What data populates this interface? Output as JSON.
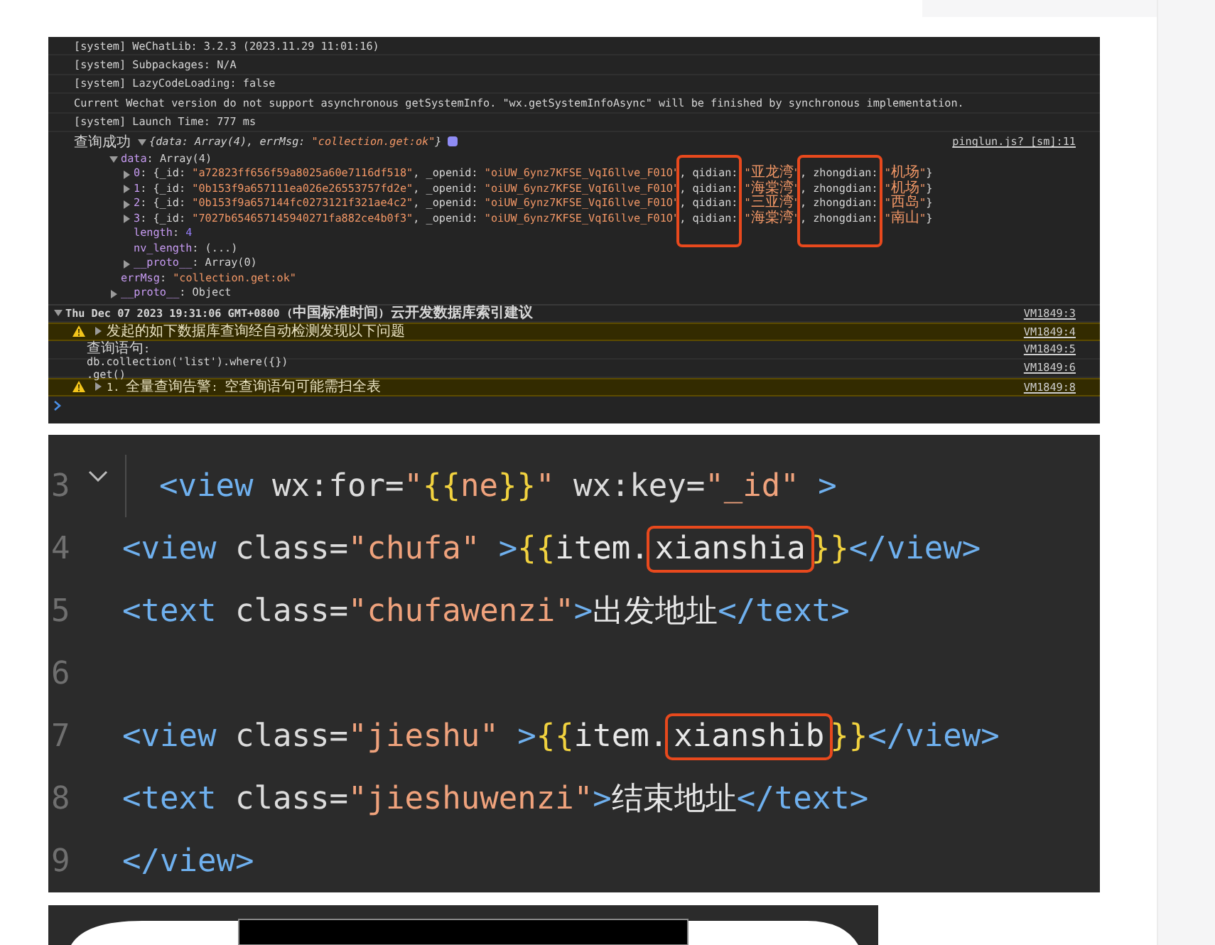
{
  "console": {
    "lines": [
      {
        "kind": "log",
        "text": "[system] WeChatLib: 3.2.3 (2023.11.29 11:01:16)"
      },
      {
        "kind": "log",
        "text": "[system] Subpackages: N/A"
      },
      {
        "kind": "log",
        "text": "[system] LazyCodeLoading: false"
      },
      {
        "kind": "log",
        "text": "Current Wechat version do not support asynchronous getSystemInfo. \"wx.getSystemInfoAsync\" will be finished by synchronous implementation."
      },
      {
        "kind": "log",
        "text": "[system] Launch Time: 777 ms"
      },
      {
        "kind": "object",
        "label": "查询成功",
        "expanded": true,
        "summary": [
          {
            "kind": "plain",
            "text": "{data: Array(4), errMsg: "
          },
          {
            "kind": "string",
            "text": "\"collection.get:ok\""
          },
          {
            "kind": "plain",
            "text": "}"
          }
        ],
        "source": "pinglun.js? [sm]:11",
        "children": [
          {
            "expanded": true,
            "tokens": [
              {
                "kind": "key",
                "text": "data"
              },
              {
                "kind": "plain",
                "text": ": Array(4)"
              }
            ],
            "children": [
              {
                "expanded": false,
                "tokens": [
                  {
                    "kind": "key",
                    "text": "0"
                  },
                  {
                    "kind": "plain",
                    "text": ": {_id: "
                  },
                  {
                    "kind": "string",
                    "text": "\"a72823ff656f59a8025a60e7116df518\""
                  },
                  {
                    "kind": "plain",
                    "text": ", _openid: "
                  },
                  {
                    "kind": "string",
                    "text": "\"oiUW_6ynz7KFSE_VqI6llve_F01O\""
                  },
                  {
                    "kind": "plain",
                    "text": ", qidian:",
                    "highlighted": true
                  },
                  {
                    "kind": "string",
                    "text": " \"亚龙湾\""
                  },
                  {
                    "kind": "plain",
                    "text": ", zhongdian:",
                    "highlighted": true
                  },
                  {
                    "kind": "string",
                    "text": " \"机场\""
                  },
                  {
                    "kind": "plain",
                    "text": "}"
                  }
                ]
              },
              {
                "expanded": false,
                "tokens": [
                  {
                    "kind": "key",
                    "text": "1"
                  },
                  {
                    "kind": "plain",
                    "text": ": {_id: "
                  },
                  {
                    "kind": "string",
                    "text": "\"0b153f9a657111ea026e26553757fd2e\""
                  },
                  {
                    "kind": "plain",
                    "text": ", _openid: "
                  },
                  {
                    "kind": "string",
                    "text": "\"oiUW_6ynz7KFSE_VqI6llve_F01O\""
                  },
                  {
                    "kind": "plain",
                    "text": ", qidian:",
                    "highlighted": true
                  },
                  {
                    "kind": "string",
                    "text": " \"海棠湾\""
                  },
                  {
                    "kind": "plain",
                    "text": ", zhongdian:",
                    "highlighted": true
                  },
                  {
                    "kind": "string",
                    "text": " \"机场\""
                  },
                  {
                    "kind": "plain",
                    "text": "}"
                  }
                ]
              },
              {
                "expanded": false,
                "tokens": [
                  {
                    "kind": "key",
                    "text": "2"
                  },
                  {
                    "kind": "plain",
                    "text": ": {_id: "
                  },
                  {
                    "kind": "string",
                    "text": "\"0b153f9a657144fc0273121f321ae4c2\""
                  },
                  {
                    "kind": "plain",
                    "text": ", _openid: "
                  },
                  {
                    "kind": "string",
                    "text": "\"oiUW_6ynz7KFSE_VqI6llve_F01O\""
                  },
                  {
                    "kind": "plain",
                    "text": ", qidian:",
                    "highlighted": true
                  },
                  {
                    "kind": "string",
                    "text": " \"三亚湾\""
                  },
                  {
                    "kind": "plain",
                    "text": ", zhongdian:",
                    "highlighted": true
                  },
                  {
                    "kind": "string",
                    "text": " \"西岛\""
                  },
                  {
                    "kind": "plain",
                    "text": "}"
                  }
                ]
              },
              {
                "expanded": false,
                "tokens": [
                  {
                    "kind": "key",
                    "text": "3"
                  },
                  {
                    "kind": "plain",
                    "text": ": {_id: "
                  },
                  {
                    "kind": "string",
                    "text": "\"7027b654657145940271fa882ce4b0f3\""
                  },
                  {
                    "kind": "plain",
                    "text": ", _openid: "
                  },
                  {
                    "kind": "string",
                    "text": "\"oiUW_6ynz7KFSE_VqI6llve_F01O\""
                  },
                  {
                    "kind": "plain",
                    "text": ", qidian:",
                    "highlighted": true
                  },
                  {
                    "kind": "string",
                    "text": " \"海棠湾\""
                  },
                  {
                    "kind": "plain",
                    "text": ", zhongdian:",
                    "highlighted": true
                  },
                  {
                    "kind": "string",
                    "text": " \"南山\""
                  },
                  {
                    "kind": "plain",
                    "text": "}"
                  }
                ]
              },
              {
                "tokens": [
                  {
                    "kind": "key",
                    "text": "length"
                  },
                  {
                    "kind": "plain",
                    "text": ": "
                  },
                  {
                    "kind": "number",
                    "text": "4"
                  }
                ]
              },
              {
                "tokens": [
                  {
                    "kind": "key",
                    "text": "nv_length"
                  },
                  {
                    "kind": "plain",
                    "text": ": (...)"
                  }
                ]
              },
              {
                "expanded": false,
                "tokens": [
                  {
                    "kind": "key",
                    "text": "__proto__"
                  },
                  {
                    "kind": "plain",
                    "text": ": Array(0)"
                  }
                ]
              }
            ]
          },
          {
            "tokens": [
              {
                "kind": "key",
                "text": "errMsg"
              },
              {
                "kind": "plain",
                "text": ": "
              },
              {
                "kind": "string",
                "text": "\"collection.get:ok\""
              }
            ]
          },
          {
            "expanded": false,
            "tokens": [
              {
                "kind": "key",
                "text": "__proto__"
              },
              {
                "kind": "plain",
                "text": ": Object"
              }
            ]
          }
        ]
      },
      {
        "kind": "group",
        "expanded": true,
        "text": "Thu Dec 07 2023 19:31:06 GMT+0800 (中国标准时间) 云开发数据库索引建议",
        "source": "VM1849:3",
        "children": [
          {
            "kind": "warning",
            "expanded": false,
            "text": "发起的如下数据库查询经自动检测发现以下问题",
            "source": "VM1849:4"
          },
          {
            "kind": "log",
            "text": "查询语句:",
            "source": "VM1849:5"
          },
          {
            "kind": "log",
            "text": "db.collection('list').where({})\n.get()",
            "source": "VM1849:6"
          },
          {
            "kind": "warning",
            "expanded": false,
            "text": "1. 全量查询告警: 空查询语句可能需扫全表",
            "source": "VM1849:8"
          }
        ]
      }
    ]
  },
  "code": {
    "lines": [
      {
        "number": "3",
        "expanded": true,
        "tokens": [
          {
            "kind": "tag",
            "text": "<view"
          },
          {
            "kind": "attr",
            "text": " wx:for="
          },
          {
            "kind": "string",
            "text": "\""
          },
          {
            "kind": "brace",
            "text": "{{"
          },
          {
            "kind": "string",
            "text": "ne"
          },
          {
            "kind": "brace",
            "text": "}}"
          },
          {
            "kind": "string",
            "text": "\""
          },
          {
            "kind": "attr",
            "text": " wx:key="
          },
          {
            "kind": "string",
            "text": "\"_id\""
          },
          {
            "kind": "tag",
            "text": " >"
          }
        ]
      },
      {
        "number": "4",
        "tokens": [
          {
            "kind": "tag",
            "text": "<view"
          },
          {
            "kind": "attr",
            "text": " class="
          },
          {
            "kind": "string",
            "text": "\"chufa\""
          },
          {
            "kind": "tag",
            "text": " >"
          },
          {
            "kind": "brace",
            "text": "{{"
          },
          {
            "kind": "text",
            "text": "item."
          },
          {
            "kind": "text",
            "text": "xianshia",
            "highlighted": true
          },
          {
            "kind": "brace",
            "text": "}}"
          },
          {
            "kind": "tag",
            "text": "</view>"
          }
        ]
      },
      {
        "number": "5",
        "tokens": [
          {
            "kind": "tag",
            "text": "<text"
          },
          {
            "kind": "attr",
            "text": " class="
          },
          {
            "kind": "string",
            "text": "\"chufawenzi\""
          },
          {
            "kind": "tag",
            "text": ">"
          },
          {
            "kind": "text",
            "text": "出发地址"
          },
          {
            "kind": "tag",
            "text": "</text>"
          }
        ]
      },
      {
        "number": "6"
      },
      {
        "number": "7",
        "tokens": [
          {
            "kind": "tag",
            "text": "<view"
          },
          {
            "kind": "attr",
            "text": " class="
          },
          {
            "kind": "string",
            "text": "\"jieshu\""
          },
          {
            "kind": "tag",
            "text": " >"
          },
          {
            "kind": "brace",
            "text": "{{"
          },
          {
            "kind": "text",
            "text": "item."
          },
          {
            "kind": "text",
            "text": "xianshib",
            "highlighted": true
          },
          {
            "kind": "brace",
            "text": "}}"
          },
          {
            "kind": "tag",
            "text": "</view>"
          }
        ]
      },
      {
        "number": "8",
        "tokens": [
          {
            "kind": "tag",
            "text": "<text"
          },
          {
            "kind": "attr",
            "text": " class="
          },
          {
            "kind": "string",
            "text": "\"jieshuwenzi\""
          },
          {
            "kind": "tag",
            "text": ">"
          },
          {
            "kind": "text",
            "text": "结束地址"
          },
          {
            "kind": "tag",
            "text": "</text>"
          }
        ]
      },
      {
        "number": "9",
        "tokens": [
          {
            "kind": "tag",
            "text": "</view>"
          }
        ]
      }
    ]
  }
}
